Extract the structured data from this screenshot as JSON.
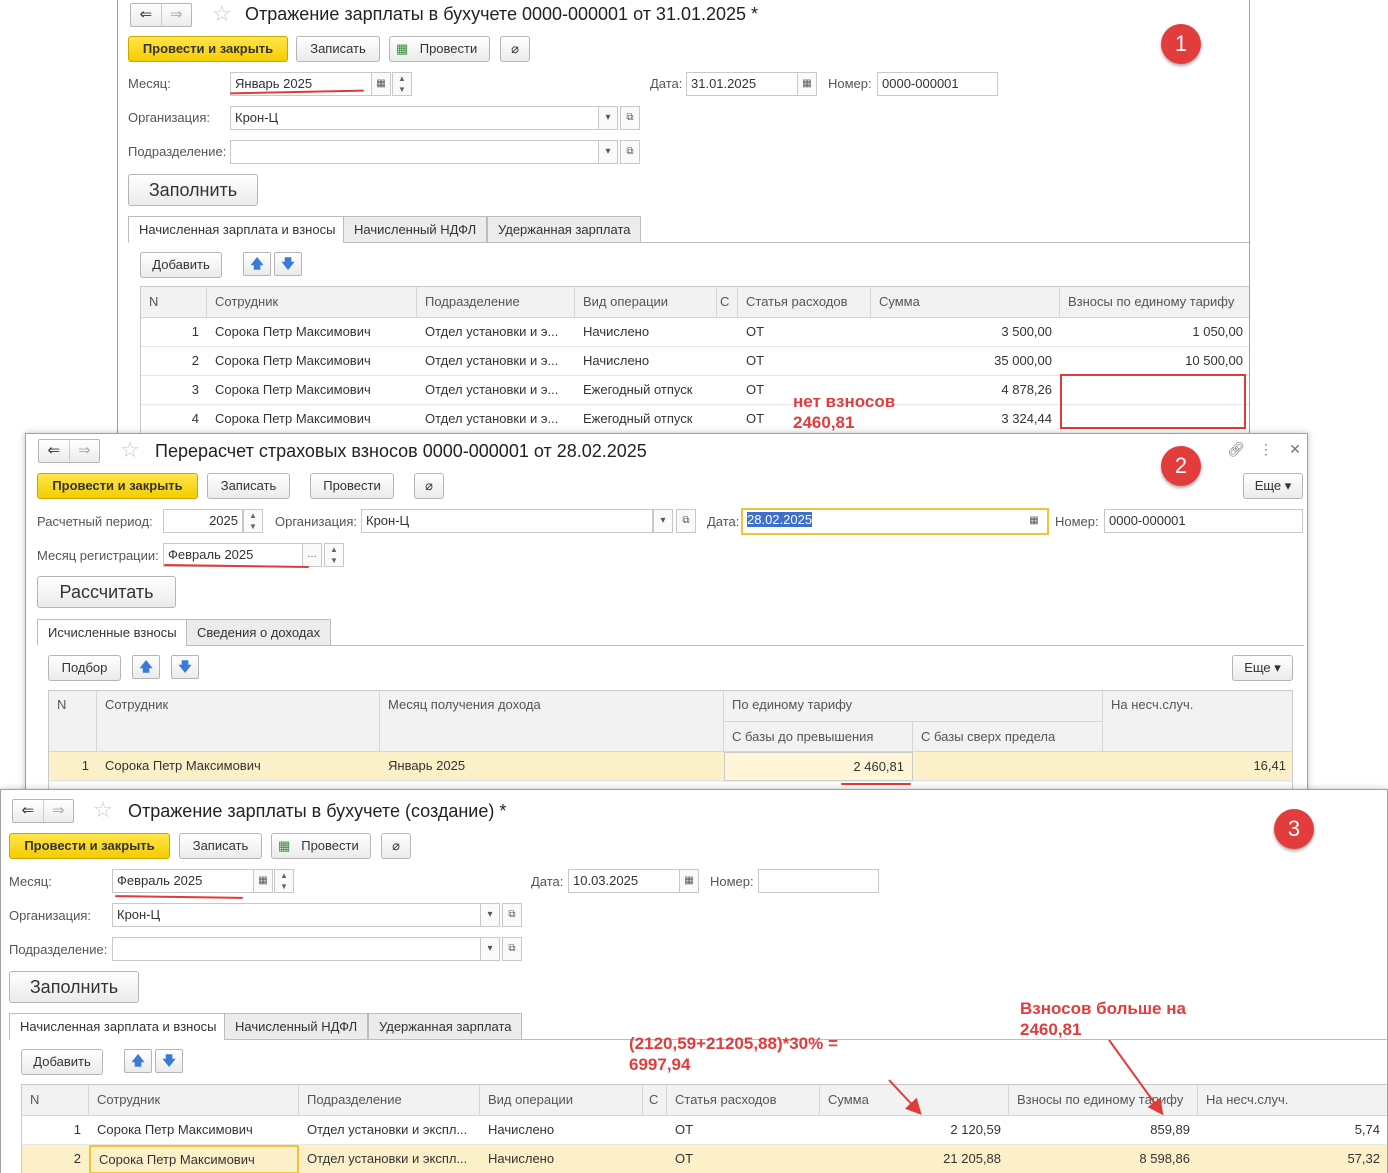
{
  "w1": {
    "title": "Отражение зарплаты в бухучете 0000-000001 от 31.01.2025 *",
    "toolbar": {
      "post_close": "Провести и закрыть",
      "save": "Записать",
      "post": "Провести"
    },
    "month_label": "Месяц:",
    "month_value": "Январь 2025",
    "date_label": "Дата:",
    "date_value": "31.01.2025",
    "number_label": "Номер:",
    "number_value": "0000-000001",
    "org_label": "Организация:",
    "org_value": "Крон-Ц",
    "dept_label": "Подразделение:",
    "dept_value": "",
    "fill_button": "Заполнить",
    "tabs": [
      "Начисленная зарплата и взносы",
      "Начисленный НДФЛ",
      "Удержанная зарплата"
    ],
    "add_button": "Добавить",
    "columns": [
      "N",
      "Сотрудник",
      "Подразделение",
      "Вид операции",
      "С",
      "Статья расходов",
      "Сумма",
      "Взносы по единому тарифу"
    ],
    "rows": [
      [
        "1",
        "Сорока Петр Максимович",
        "Отдел установки и э...",
        "Начислено",
        "",
        "ОТ",
        "3 500,00",
        "1 050,00"
      ],
      [
        "2",
        "Сорока Петр Максимович",
        "Отдел установки и э...",
        "Начислено",
        "",
        "ОТ",
        "35 000,00",
        "10 500,00"
      ],
      [
        "3",
        "Сорока Петр Максимович",
        "Отдел установки и э...",
        "Ежегодный отпуск",
        "",
        "ОТ",
        "4 878,26",
        ""
      ],
      [
        "4",
        "Сорока Петр Максимович",
        "Отдел установки и э...",
        "Ежегодный отпуск",
        "",
        "ОТ",
        "3 324,44",
        ""
      ]
    ],
    "badge": "1",
    "annotation_line1": "нет взносов",
    "annotation_line2": "2460,81"
  },
  "w2": {
    "title": "Перерасчет страховых взносов 0000-000001 от 28.02.2025",
    "toolbar": {
      "post_close": "Провести и закрыть",
      "save": "Записать",
      "post": "Провести",
      "more": "Еще"
    },
    "period_label": "Расчетный период:",
    "period_value": "2025",
    "org_label": "Организация:",
    "org_value": "Крон-Ц",
    "date_label": "Дата:",
    "date_value": "28.02.2025",
    "number_label": "Номер:",
    "number_value": "0000-000001",
    "reg_month_label": "Месяц регистрации:",
    "reg_month_value": "Февраль 2025",
    "calc_button": "Рассчитать",
    "tabs": [
      "Исчисленные взносы",
      "Сведения о доходах"
    ],
    "pick_button": "Подбор",
    "more2": "Еще",
    "columns": {
      "n": "N",
      "emp": "Сотрудник",
      "month": "Месяц получения дохода",
      "unified": "По единому тарифу",
      "base_before": "С базы до превышения",
      "base_over": "С базы сверх предела",
      "accident": "На несч.случ."
    },
    "row": [
      "1",
      "Сорока Петр Максимович",
      "Январь 2025",
      "2 460,81",
      "",
      "16,41"
    ],
    "badge": "2"
  },
  "w3": {
    "title": "Отражение зарплаты в бухучете (создание) *",
    "toolbar": {
      "post_close": "Провести и закрыть",
      "save": "Записать",
      "post": "Провести"
    },
    "month_label": "Месяц:",
    "month_value": "Февраль 2025",
    "date_label": "Дата:",
    "date_value": "10.03.2025",
    "number_label": "Номер:",
    "number_value": "",
    "org_label": "Организация:",
    "org_value": "Крон-Ц",
    "dept_label": "Подразделение:",
    "dept_value": "",
    "fill_button": "Заполнить",
    "tabs": [
      "Начисленная зарплата и взносы",
      "Начисленный НДФЛ",
      "Удержанная зарплата"
    ],
    "add_button": "Добавить",
    "columns": [
      "N",
      "Сотрудник",
      "Подразделение",
      "Вид операции",
      "С",
      "Статья расходов",
      "Сумма",
      "Взносы по единому тарифу",
      "На несч.случ."
    ],
    "rows": [
      [
        "1",
        "Сорока Петр Максимович",
        "Отдел установки и экспл...",
        "Начислено",
        "",
        "ОТ",
        "2 120,59",
        "859,89",
        "5,74"
      ],
      [
        "2",
        "Сорока Петр Максимович",
        "Отдел установки и экспл...",
        "Начислено",
        "",
        "ОТ",
        "21 205,88",
        "8 598,86",
        "57,32"
      ]
    ],
    "badge": "3",
    "formula_line1": "(2120,59+21205,88)*30% =",
    "formula_line2": "6997,94",
    "more_line1": "Взносов больше на",
    "more_line2": "2460,81"
  }
}
